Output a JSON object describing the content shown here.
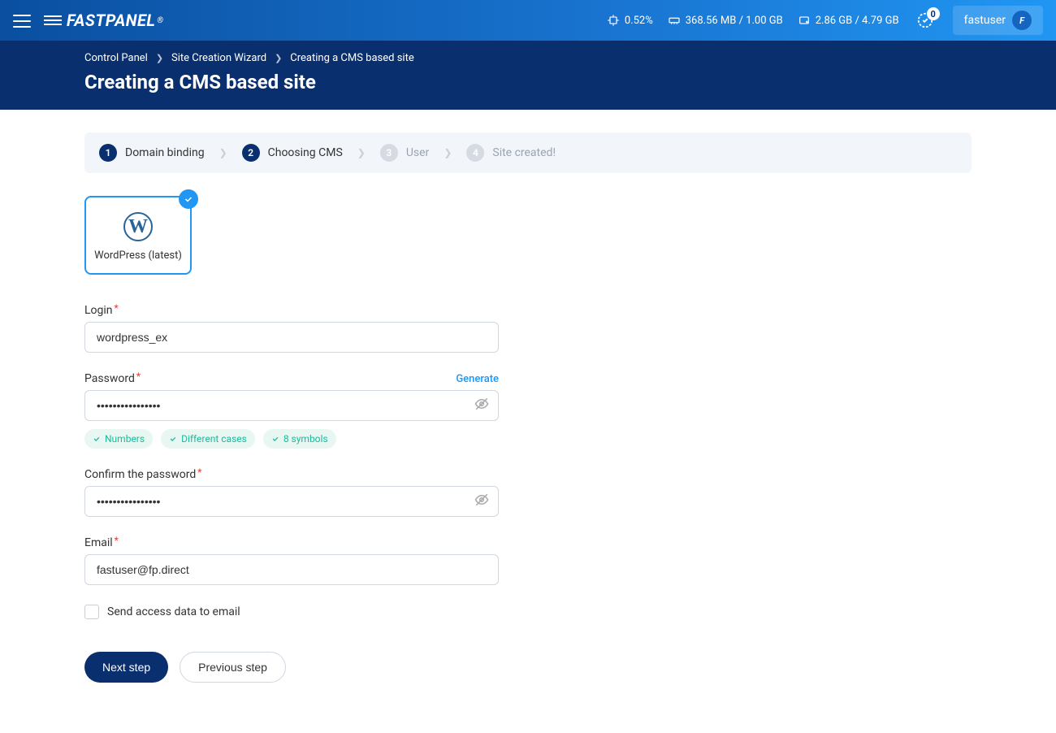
{
  "topbar": {
    "logo_text": "FASTPANEL",
    "logo_reg": "®",
    "cpu_pct": "0.52%",
    "ram": "368.56 MB / 1.00 GB",
    "disk": "2.86 GB / 4.79 GB",
    "notif_count": "0",
    "username": "fastuser",
    "avatar_letter": "F"
  },
  "breadcrumb": {
    "items": [
      "Control Panel",
      "Site Creation Wizard",
      "Creating a CMS based site"
    ]
  },
  "page_title": "Creating a CMS based site",
  "steps": [
    {
      "num": "1",
      "label": "Domain binding",
      "state": "done"
    },
    {
      "num": "2",
      "label": "Choosing CMS",
      "state": "active"
    },
    {
      "num": "3",
      "label": "User",
      "state": "pending"
    },
    {
      "num": "4",
      "label": "Site created!",
      "state": "pending"
    }
  ],
  "cms": {
    "name": "WordPress (latest)",
    "logo_letter": "W"
  },
  "form": {
    "login_label": "Login",
    "login_value": "wordpress_ex",
    "password_label": "Password",
    "generate_label": "Generate",
    "password_value": "••••••••••••••••",
    "hints": [
      "Numbers",
      "Different cases",
      "8 symbols"
    ],
    "confirm_label": "Confirm the password",
    "confirm_value": "••••••••••••••••",
    "email_label": "Email",
    "email_value": "fastuser@fp.direct",
    "send_email_label": "Send access data to email"
  },
  "buttons": {
    "next": "Next step",
    "prev": "Previous step"
  }
}
